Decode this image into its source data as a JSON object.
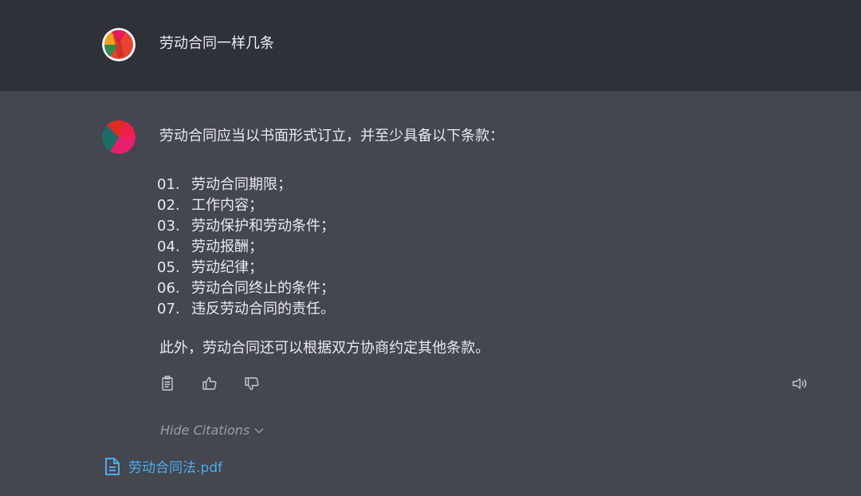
{
  "question": {
    "text": "劳动合同一样几条"
  },
  "answer": {
    "intro": "劳动合同应当以书面形式订立，并至少具备以下条款：",
    "items": [
      {
        "num": "01.",
        "text": "劳动合同期限；"
      },
      {
        "num": "02.",
        "text": "工作内容；"
      },
      {
        "num": "03.",
        "text": "劳动保护和劳动条件；"
      },
      {
        "num": "04.",
        "text": "劳动报酬；"
      },
      {
        "num": "05.",
        "text": "劳动纪律；"
      },
      {
        "num": "06.",
        "text": "劳动合同终止的条件；"
      },
      {
        "num": "07.",
        "text": "违反劳动合同的责任。"
      }
    ],
    "outro": "此外，劳动合同还可以根据双方协商约定其他条款。"
  },
  "actions": {
    "copy_icon": "clipboard-icon",
    "like_icon": "thumbs-up-icon",
    "dislike_icon": "thumbs-down-icon",
    "speak_icon": "speaker-icon"
  },
  "citations": {
    "toggle_label": "Hide Citations",
    "items": [
      {
        "name": "劳动合同法.pdf",
        "icon": "document-icon"
      }
    ]
  },
  "colors": {
    "top_bg": "#2f3139",
    "body_bg": "#444650",
    "link": "#4aaee8"
  }
}
